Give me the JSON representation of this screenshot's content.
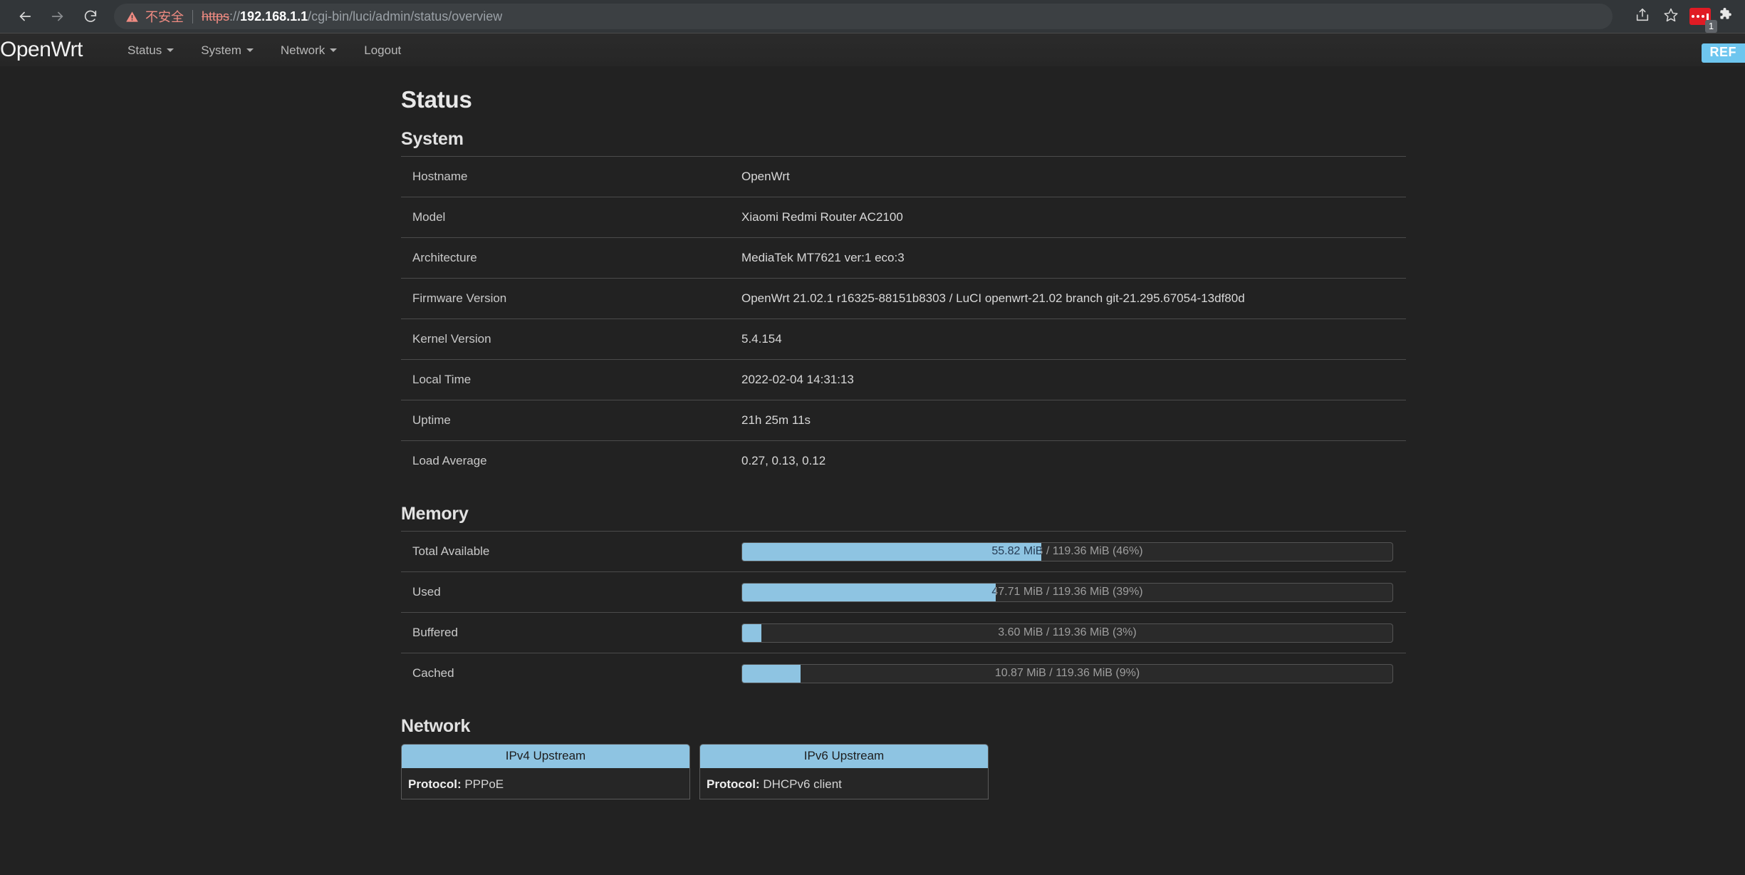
{
  "browser": {
    "back_icon": "back-arrow-icon",
    "forward_icon": "forward-arrow-icon",
    "reload_icon": "reload-icon",
    "security_warning_label": "不安全",
    "url": {
      "scheme": "https",
      "separator": "://",
      "host": "192.168.1.1",
      "path": "/cgi-bin/luci/admin/status/overview",
      "full": "https://192.168.1.1/cgi-bin/luci/admin/status/overview"
    },
    "share_icon": "share-icon",
    "bookmark_icon": "star-icon",
    "extension_badge_count": "1",
    "puzzle_icon": "extensions-puzzle-icon"
  },
  "header": {
    "brand": "OpenWrt",
    "menu": [
      {
        "label": "Status",
        "has_caret": true
      },
      {
        "label": "System",
        "has_caret": true
      },
      {
        "label": "Network",
        "has_caret": true
      },
      {
        "label": "Logout",
        "has_caret": false
      }
    ],
    "refresh_badge": "REF",
    "accent_color": "#6ec6ef"
  },
  "page": {
    "title": "Status"
  },
  "system": {
    "title": "System",
    "rows": [
      {
        "label": "Hostname",
        "value": "OpenWrt"
      },
      {
        "label": "Model",
        "value": "Xiaomi Redmi Router AC2100"
      },
      {
        "label": "Architecture",
        "value": "MediaTek MT7621 ver:1 eco:3"
      },
      {
        "label": "Firmware Version",
        "value": "OpenWrt 21.02.1 r16325-88151b8303 / LuCI openwrt-21.02 branch git-21.295.67054-13df80d"
      },
      {
        "label": "Kernel Version",
        "value": "5.4.154"
      },
      {
        "label": "Local Time",
        "value": "2022-02-04 14:31:13"
      },
      {
        "label": "Uptime",
        "value": "21h 25m 11s"
      },
      {
        "label": "Load Average",
        "value": "0.27, 0.13, 0.12"
      }
    ]
  },
  "memory": {
    "title": "Memory",
    "bar_color": "#8ec4e2",
    "rows": [
      {
        "label": "Total Available",
        "text": "55.82 MiB / 119.36 MiB (46%)",
        "percent": 46
      },
      {
        "label": "Used",
        "text": "47.71 MiB / 119.36 MiB (39%)",
        "percent": 39
      },
      {
        "label": "Buffered",
        "text": "3.60 MiB / 119.36 MiB (3%)",
        "percent": 3
      },
      {
        "label": "Cached",
        "text": "10.87 MiB / 119.36 MiB (9%)",
        "percent": 9
      }
    ]
  },
  "network": {
    "title": "Network",
    "panels": [
      {
        "title": "IPv4 Upstream",
        "protocol_label": "Protocol:",
        "protocol_value": "PPPoE"
      },
      {
        "title": "IPv6 Upstream",
        "protocol_label": "Protocol:",
        "protocol_value": "DHCPv6 client"
      }
    ]
  }
}
